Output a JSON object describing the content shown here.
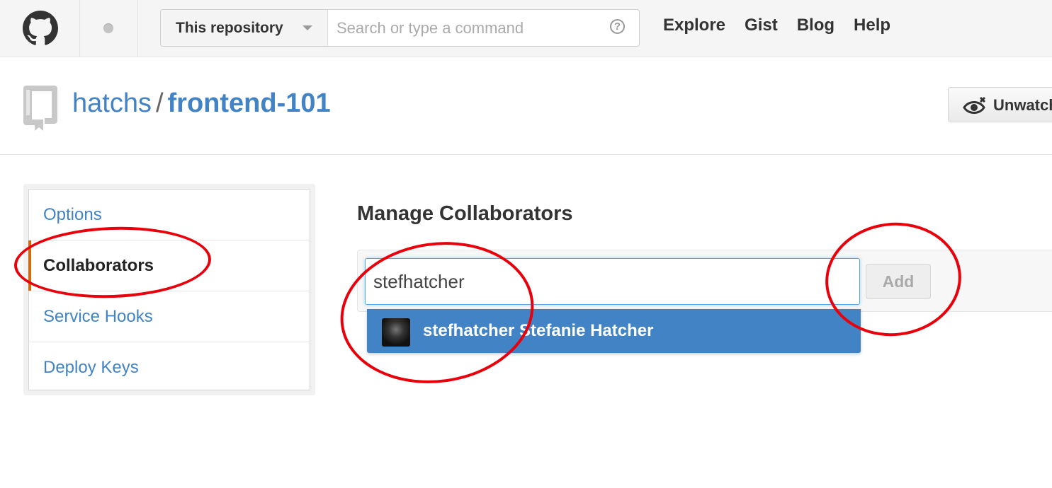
{
  "header": {
    "logo_icon": "github-octocat-icon",
    "search_scope": "This repository",
    "search_placeholder": "Search or type a command",
    "help_glyph": "?",
    "nav": [
      "Explore",
      "Gist",
      "Blog",
      "Help"
    ]
  },
  "repo": {
    "owner": "hatchs",
    "separator": "/",
    "name": "frontend-101",
    "watch_label": "Unwatch"
  },
  "sidebar": {
    "items": [
      {
        "label": "Options",
        "selected": false
      },
      {
        "label": "Collaborators",
        "selected": true
      },
      {
        "label": "Service Hooks",
        "selected": false
      },
      {
        "label": "Deploy Keys",
        "selected": false
      }
    ]
  },
  "main": {
    "title": "Manage Collaborators",
    "input_value": "stefhatcher",
    "add_label": "Add",
    "suggestion": {
      "username": "stefhatcher",
      "fullname": "Stefanie Hatcher"
    }
  },
  "colors": {
    "link": "#4183c4",
    "selected_marker": "#d26911",
    "annotation": "#e8000b"
  }
}
